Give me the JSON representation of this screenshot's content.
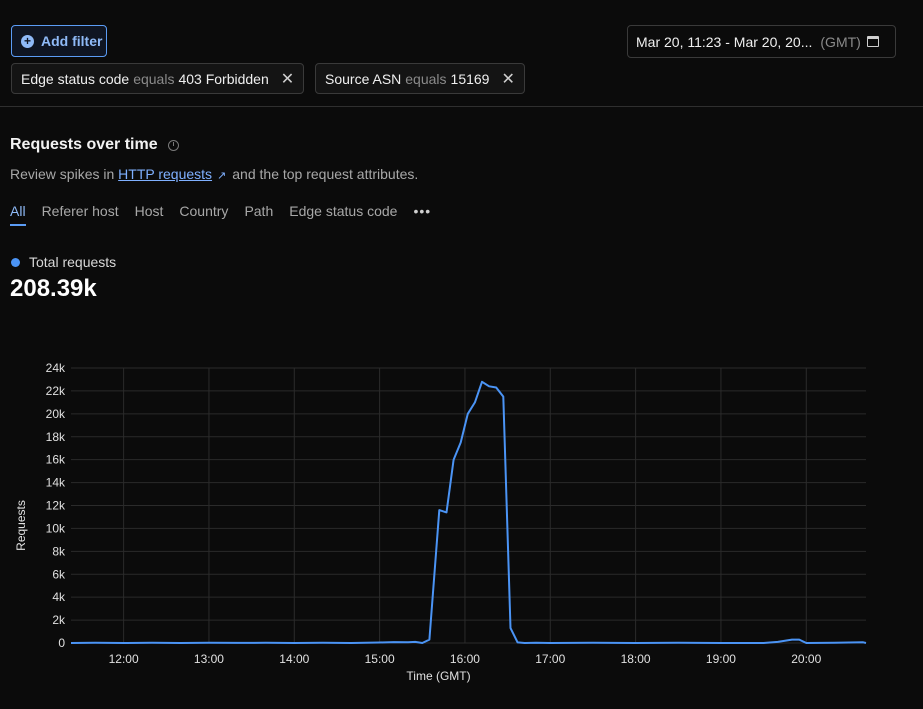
{
  "toolbar": {
    "add_filter_label": "Add filter"
  },
  "date_range": {
    "label": "Mar 20, 11:23 - Mar 20, 20...",
    "timezone": "(GMT)"
  },
  "filters": [
    {
      "field": "Edge status code",
      "operator": "equals",
      "value": "403 Forbidden"
    },
    {
      "field": "Source ASN",
      "operator": "equals",
      "value": "15169"
    }
  ],
  "section": {
    "title": "Requests over time",
    "desc_prefix": "Review spikes in",
    "desc_link": "HTTP requests",
    "desc_suffix": "and the top request attributes."
  },
  "tabs": [
    "All",
    "Referer host",
    "Host",
    "Country",
    "Path",
    "Edge status code"
  ],
  "tabs_more": "•••",
  "legend_label": "Total requests",
  "total_value": "208.39k",
  "colors": {
    "accent": "#4b94f5",
    "link": "#7fb0ff"
  },
  "chart_data": {
    "type": "line",
    "xlabel": "Time (GMT)",
    "ylabel": "Requests",
    "xlim": [
      "11:23",
      "20:42"
    ],
    "ylim": [
      0,
      24000
    ],
    "y_ticks": [
      0,
      2000,
      4000,
      6000,
      8000,
      10000,
      12000,
      14000,
      16000,
      18000,
      20000,
      22000,
      24000
    ],
    "y_tick_labels": [
      "0",
      "2k",
      "4k",
      "6k",
      "8k",
      "10k",
      "12k",
      "14k",
      "16k",
      "18k",
      "20k",
      "22k",
      "24k"
    ],
    "x_ticks": [
      "12:00",
      "13:00",
      "14:00",
      "15:00",
      "16:00",
      "17:00",
      "18:00",
      "19:00",
      "20:00"
    ],
    "grid": true,
    "series": [
      {
        "name": "Total requests",
        "x": [
          "11:23",
          "11:40",
          "12:00",
          "12:20",
          "12:40",
          "13:00",
          "13:20",
          "13:40",
          "14:00",
          "14:20",
          "14:40",
          "15:00",
          "15:10",
          "15:20",
          "15:25",
          "15:30",
          "15:35",
          "15:42",
          "15:47",
          "15:52",
          "15:57",
          "16:02",
          "16:07",
          "16:12",
          "16:17",
          "16:22",
          "16:27",
          "16:32",
          "16:37",
          "16:42",
          "16:50",
          "17:00",
          "17:30",
          "18:00",
          "18:30",
          "19:00",
          "19:30",
          "19:40",
          "19:50",
          "19:55",
          "20:00",
          "20:20",
          "20:40",
          "20:42"
        ],
        "values": [
          0,
          20,
          0,
          20,
          0,
          30,
          10,
          20,
          0,
          20,
          0,
          40,
          80,
          60,
          100,
          0,
          300,
          11600,
          11400,
          16000,
          17500,
          20000,
          21000,
          22800,
          22400,
          22300,
          21500,
          1300,
          50,
          0,
          20,
          0,
          20,
          0,
          20,
          0,
          0,
          100,
          300,
          300,
          0,
          20,
          60,
          0
        ]
      }
    ]
  }
}
